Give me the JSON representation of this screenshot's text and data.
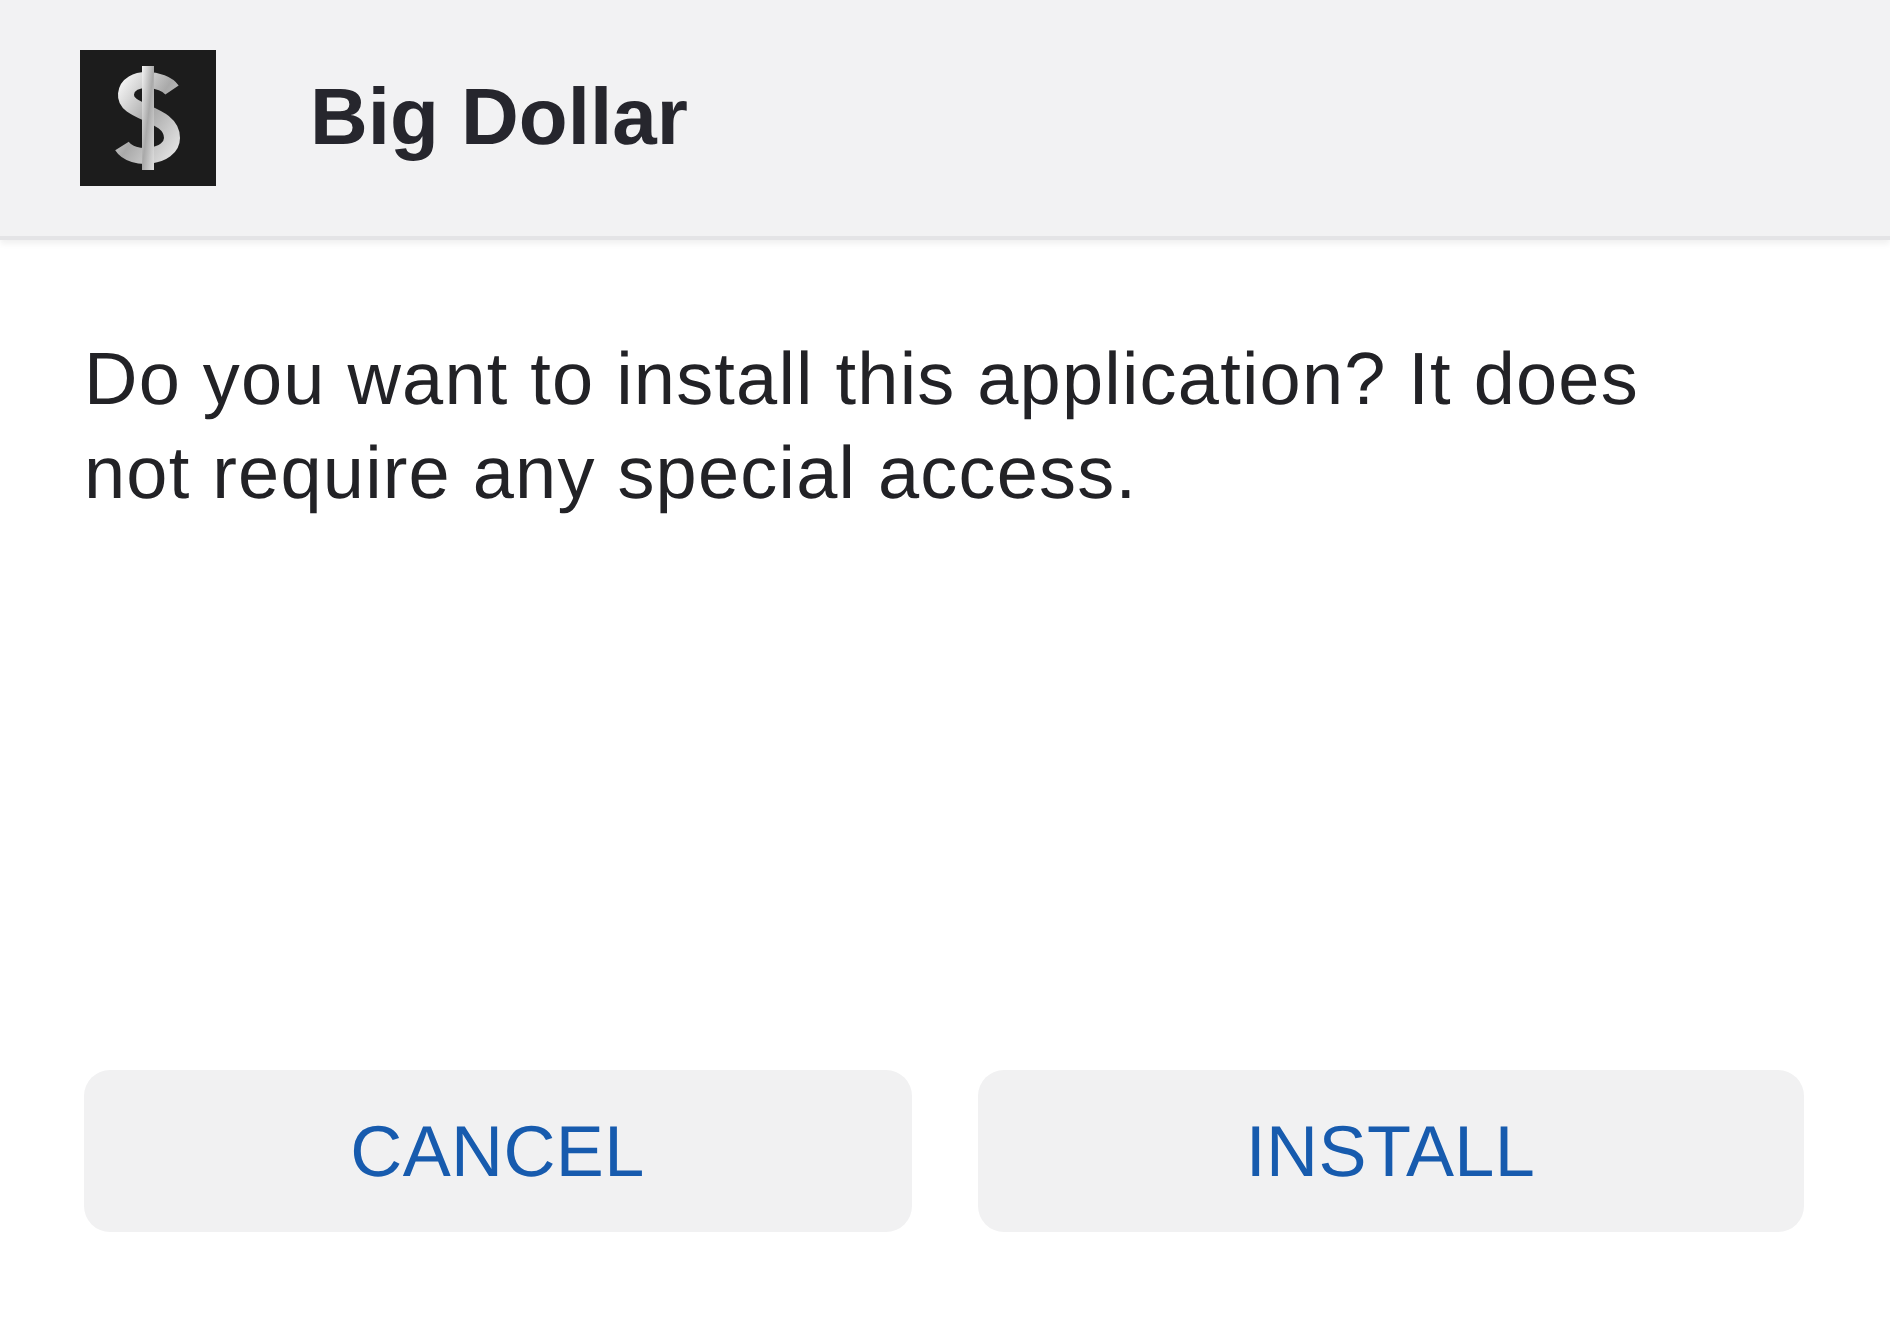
{
  "app": {
    "name": "Big Dollar"
  },
  "message": "Do you want to install this application? It does not require any special access.",
  "buttons": [
    {
      "label": "CANCEL"
    },
    {
      "label": "INSTALL"
    }
  ]
}
